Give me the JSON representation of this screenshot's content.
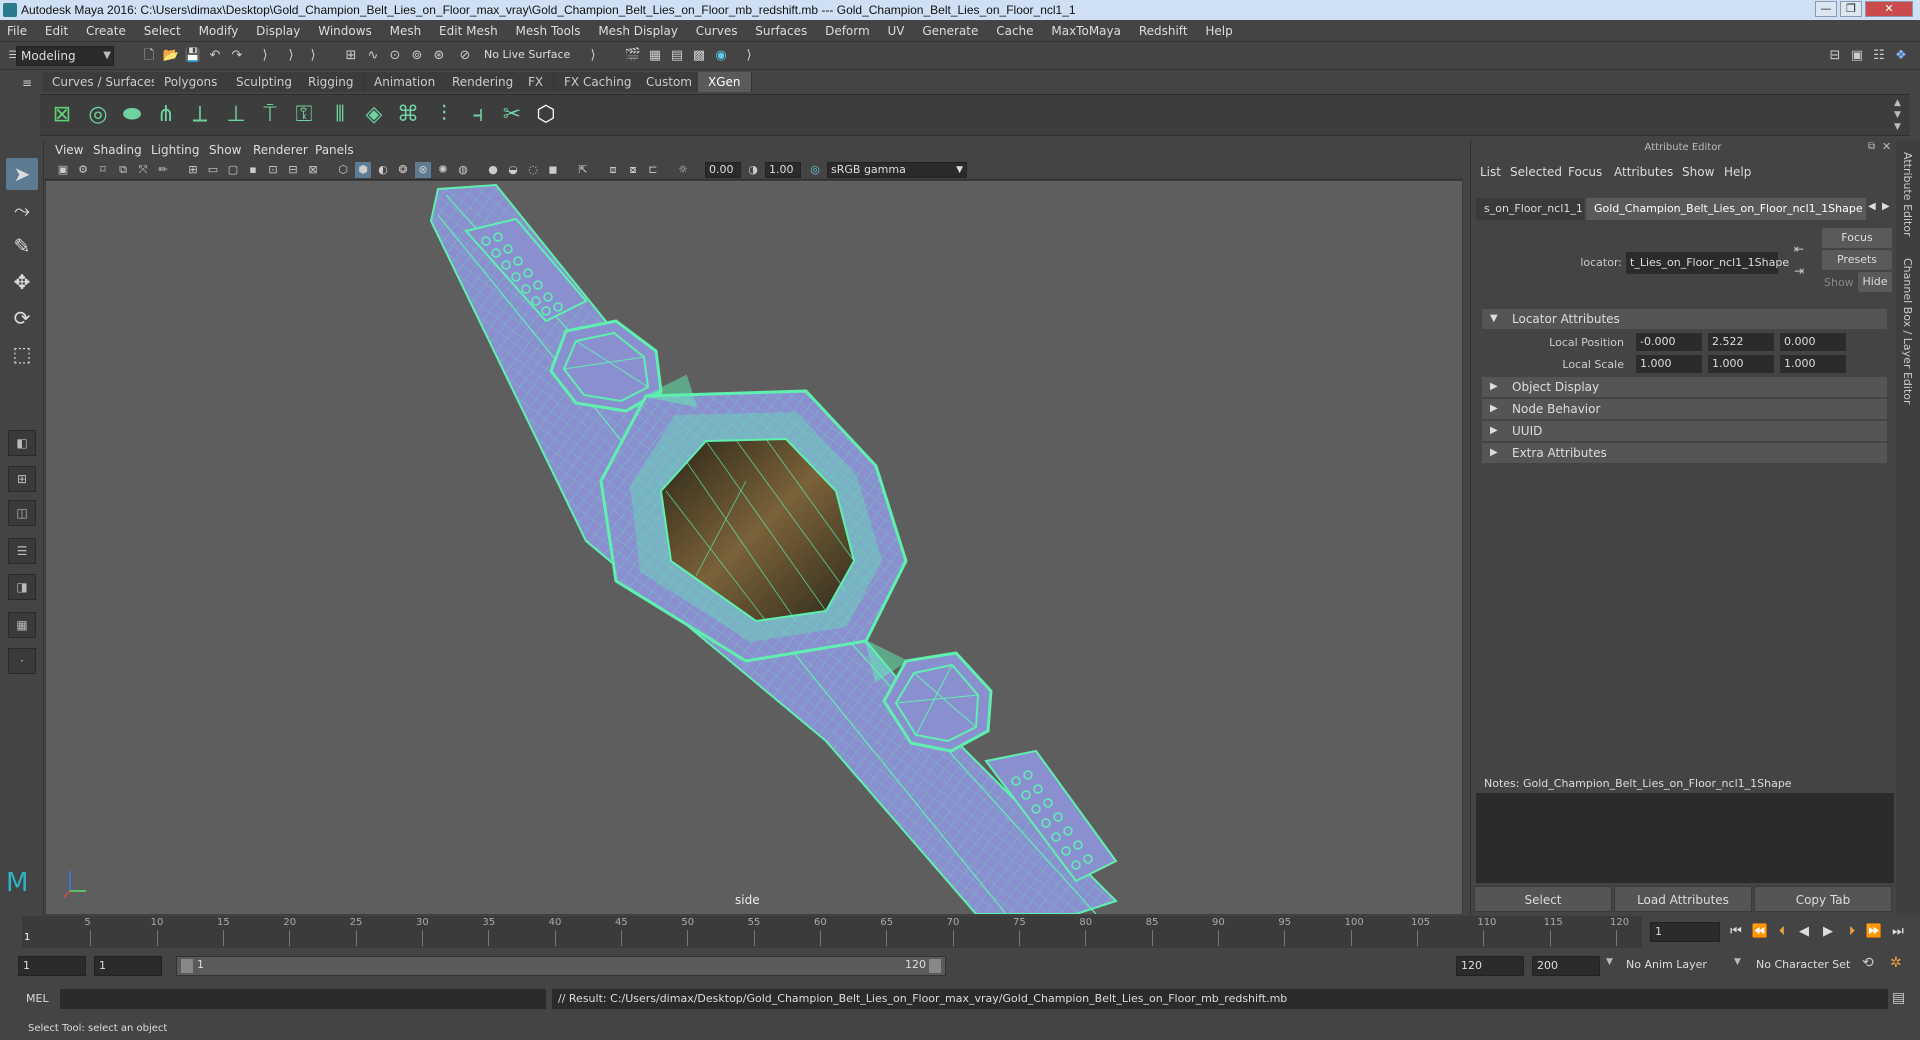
{
  "window": {
    "title": "Autodesk Maya 2016: C:\\Users\\dimax\\Desktop\\Gold_Champion_Belt_Lies_on_Floor_max_vray\\Gold_Champion_Belt_Lies_on_Floor_mb_redshift.mb   ---   Gold_Champion_Belt_Lies_on_Floor_ncl1_1",
    "minimize": "—",
    "maximize": "❐",
    "close": "✕"
  },
  "menubar": [
    "File",
    "Edit",
    "Create",
    "Select",
    "Modify",
    "Display",
    "Windows",
    "Mesh",
    "Edit Mesh",
    "Mesh Tools",
    "Mesh Display",
    "Curves",
    "Surfaces",
    "Deform",
    "UV",
    "Generate",
    "Cache",
    "MaxToMaya",
    "Redshift",
    "Help"
  ],
  "statusline": {
    "mode": "Modeling",
    "live_surface": "No Live Surface"
  },
  "shelf_tabs": [
    "Curves / Surfaces",
    "Polygons",
    "Sculpting",
    "Rigging",
    "Animation",
    "Rendering",
    "FX",
    "FX Caching",
    "Custom",
    "XGen"
  ],
  "active_shelf_tab": "XGen",
  "viewport": {
    "menu": [
      "View",
      "Shading",
      "Lighting",
      "Show",
      "Renderer",
      "Panels"
    ],
    "exposure": "0.00",
    "gamma": "1.00",
    "colorspace": "sRGB gamma",
    "camera_label": "side"
  },
  "attribute_editor": {
    "title": "Attribute Editor",
    "menu": [
      "List",
      "Selected",
      "Focus",
      "Attributes",
      "Show",
      "Help"
    ],
    "tab_left": "s_on_Floor_ncl1_1",
    "tab_active": "Gold_Champion_Belt_Lies_on_Floor_ncl1_1Shape",
    "locator_label": "locator:",
    "locator_value": "t_Lies_on_Floor_ncl1_1Shape",
    "focus_button": "Focus",
    "presets_button": "Presets",
    "show_label": "Show",
    "hide_button": "Hide",
    "sections": {
      "locator_attributes": "Locator Attributes",
      "object_display": "Object Display",
      "node_behavior": "Node Behavior",
      "uuid": "UUID",
      "extra_attributes": "Extra Attributes"
    },
    "local_position_label": "Local Position",
    "local_position": [
      "-0.000",
      "2.522",
      "0.000"
    ],
    "local_scale_label": "Local Scale",
    "local_scale": [
      "1.000",
      "1.000",
      "1.000"
    ],
    "notes_label": "Notes:  Gold_Champion_Belt_Lies_on_Floor_ncl1_1Shape",
    "select_button": "Select",
    "load_attributes_button": "Load Attributes",
    "copy_tab_button": "Copy Tab"
  },
  "right_strip": {
    "attribute_editor_tab": "Attribute Editor",
    "channel_box_tab": "Channel Box / Layer Editor"
  },
  "timeline": {
    "ticks": [
      5,
      10,
      15,
      20,
      25,
      30,
      35,
      40,
      45,
      50,
      55,
      60,
      65,
      70,
      75,
      80,
      85,
      90,
      95,
      100,
      105,
      110,
      115,
      120
    ],
    "current_frame_marker": "1",
    "current_frame": "1"
  },
  "range": {
    "start": "1",
    "playback_start": "1",
    "slider_start": "1",
    "slider_end": "120",
    "playback_end": "120",
    "end": "200",
    "anim_layer": "No Anim Layer",
    "character_set": "No Character Set"
  },
  "command_line": {
    "label": "MEL",
    "result": "// Result: C:/Users/dimax/Desktop/Gold_Champion_Belt_Lies_on_Floor_max_vray/Gold_Champion_Belt_Lies_on_Floor_mb_redshift.mb"
  },
  "help_line": "Select Tool: select an object",
  "colors": {
    "wire": "#5ff0b0",
    "belt_fill": "#8a8fd0",
    "viewport_bg": "#5e5e5e",
    "active_tab": "#5a5a5a"
  }
}
